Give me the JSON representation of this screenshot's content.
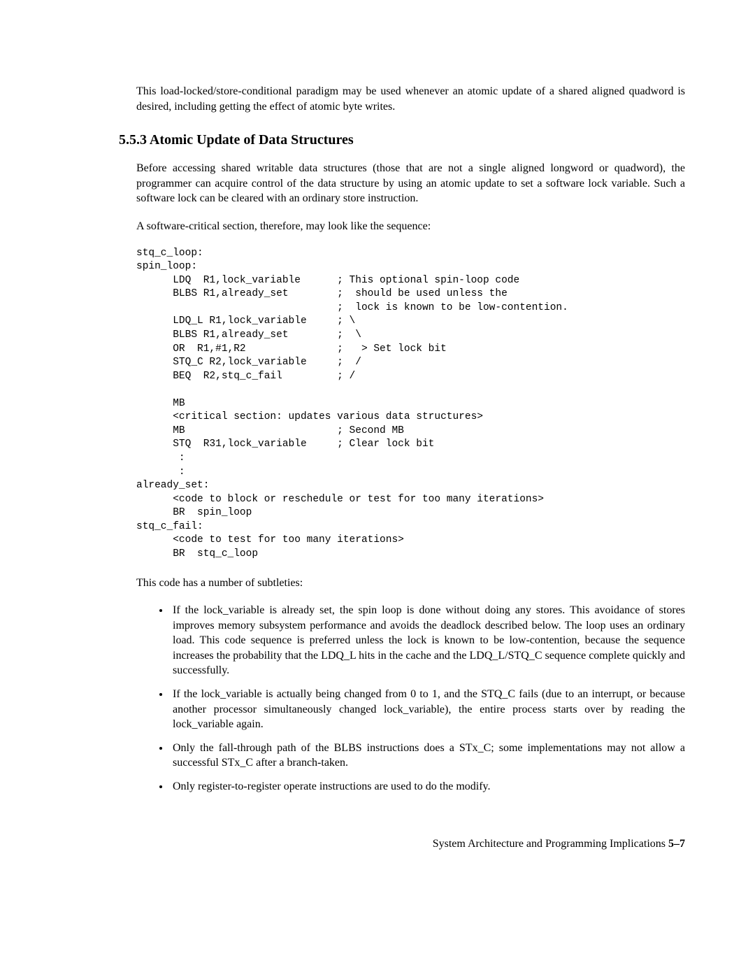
{
  "intro": "This load-locked/store-conditional paradigm may be used whenever an atomic update of a shared aligned quadword is desired, including getting the effect of atomic byte writes.",
  "heading": "5.5.3 Atomic Update of Data Structures",
  "para1": "Before accessing shared writable data structures (those that are not a single aligned longword or quadword), the programmer can acquire control of the data structure by using an atomic update to set a software lock variable. Such a software lock can be cleared with an ordinary store instruction.",
  "para2": "A software-critical section, therefore, may look like the sequence:",
  "code": "stq_c_loop:\nspin_loop:\n      LDQ  R1,lock_variable      ; This optional spin-loop code\n      BLBS R1,already_set        ;  should be used unless the\n                                 ;  lock is known to be low-contention.\n      LDQ_L R1,lock_variable     ; \\\n      BLBS R1,already_set        ;  \\\n      OR  R1,#1,R2               ;   > Set lock bit\n      STQ_C R2,lock_variable     ;  /\n      BEQ  R2,stq_c_fail         ; /\n\n      MB\n      <critical section: updates various data structures>\n      MB                         ; Second MB\n      STQ  R31,lock_variable     ; Clear lock bit\n       :\n       :\nalready_set:\n      <code to block or reschedule or test for too many iterations>\n      BR  spin_loop\nstq_c_fail:\n      <code to test for too many iterations>\n      BR  stq_c_loop",
  "para3": "This code has a number of subtleties:",
  "bullets": [
    "If the lock_variable is already set, the spin loop is done without doing any stores. This avoidance of stores improves memory subsystem performance and avoids the deadlock described below. The loop uses an ordinary load. This code sequence is preferred unless the lock is known to be low-contention, because the sequence increases the probability that the LDQ_L hits in the cache and the LDQ_L/STQ_C sequence complete quickly and successfully.",
    "If the lock_variable is actually being changed from 0 to 1, and the STQ_C fails (due to an interrupt, or because another processor simultaneously changed lock_variable), the entire process starts over by reading the lock_variable again.",
    "Only the fall-through path of the BLBS instructions does a STx_C; some implementations may not allow a successful STx_C after a branch-taken.",
    "Only register-to-register operate instructions are used to do the modify."
  ],
  "footer_text": "System Architecture and Programming Implications ",
  "footer_page": "5–7"
}
